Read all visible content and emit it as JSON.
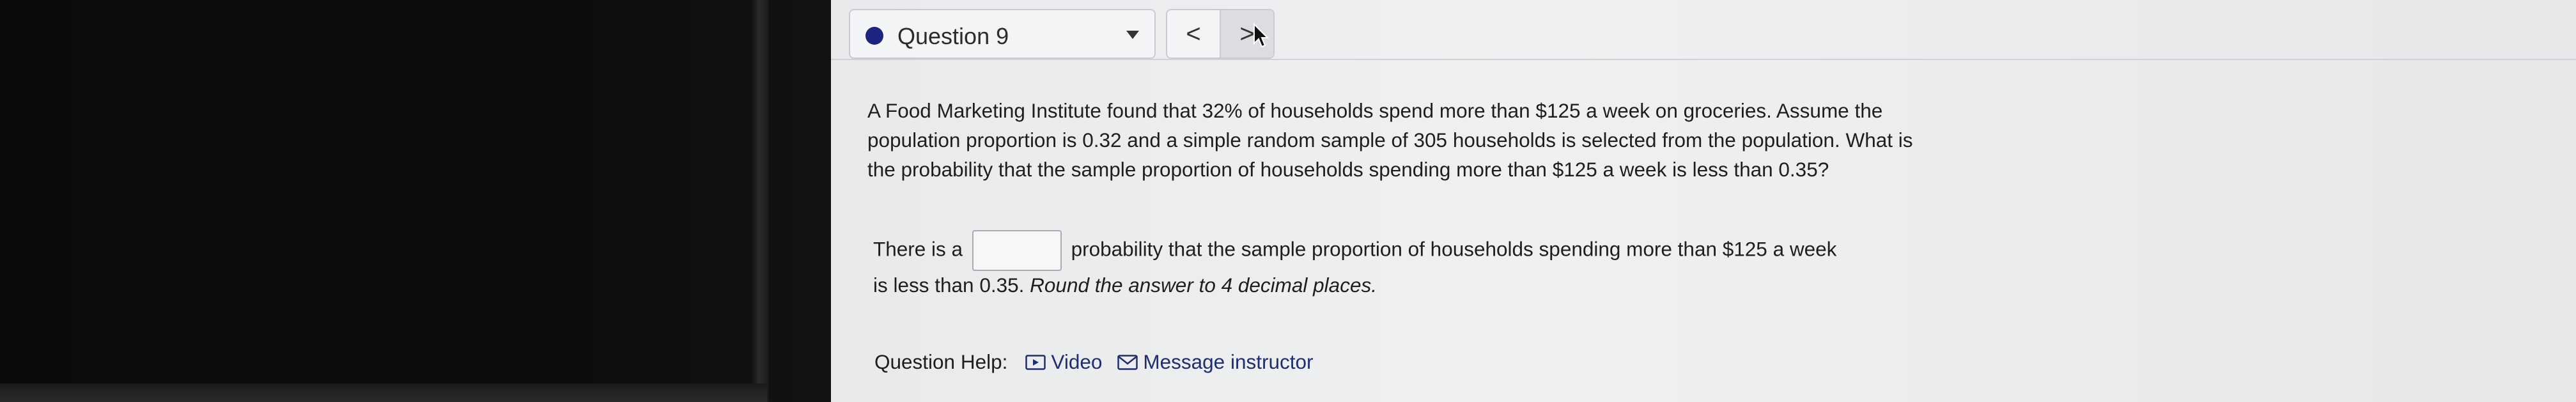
{
  "nav": {
    "question_label": "Question 9",
    "prev_label": "<",
    "next_label": ">"
  },
  "question": {
    "text": "A Food Marketing Institute found that 32% of households spend more than $125 a week on groceries. Assume the population proportion is 0.32 and a simple random sample of 305 households is selected from the population. What is the probability that the sample proportion of households spending more than $125 a week is less than 0.35?"
  },
  "answer": {
    "prefix": "There is a",
    "input_value": "",
    "suffix": "probability that the sample proportion of households spending more than $125 a week",
    "line2_plain": "is less than 0.35.",
    "line2_italic": "Round the answer to 4 decimal places."
  },
  "help": {
    "label": "Question Help:",
    "video_label": "Video",
    "message_label": "Message instructor"
  },
  "colors": {
    "accent_dot": "#1f2380",
    "link": "#1f2e6e"
  },
  "icons": {
    "video": "video-icon",
    "message": "mail-icon",
    "dropdown": "chevron-down-icon",
    "cursor": "mouse-cursor-icon"
  }
}
